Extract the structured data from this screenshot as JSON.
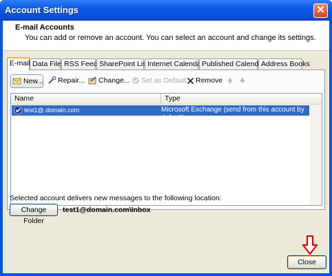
{
  "window": {
    "title": "Account Settings",
    "close_glyph": "✕"
  },
  "header": {
    "title": "E-mail Accounts",
    "description": "You can add or remove an account. You can select an account and change its settings."
  },
  "tabs": [
    {
      "label": "E-mail",
      "active": true
    },
    {
      "label": "Data Files"
    },
    {
      "label": "RSS Feeds"
    },
    {
      "label": "SharePoint Lists"
    },
    {
      "label": "Internet Calendars"
    },
    {
      "label": "Published Calendars"
    },
    {
      "label": "Address Books"
    }
  ],
  "toolbar": {
    "new": "New...",
    "repair": "Repair...",
    "change": "Change...",
    "set_default": "Set as Default",
    "remove": "Remove",
    "icons": [
      "new-account-icon",
      "repair-icon",
      "change-icon",
      "set-default-icon",
      "remove-icon",
      "move-up-icon",
      "move-down-icon"
    ]
  },
  "list": {
    "columns": {
      "name": "Name",
      "type": "Type"
    },
    "rows": [
      {
        "name": "test1@.domain.com",
        "type": "Microsoft Exchange (send from this account by default)"
      }
    ]
  },
  "delivery": {
    "text": "Selected account delivers new messages to the following location:",
    "change_folder": "Change Folder",
    "path": "test1@domain.com\\Inbox"
  },
  "footer": {
    "close": "Close"
  },
  "colors": {
    "title_bar": "#0a54e3",
    "selection": "#316ac5",
    "annotation_arrow": "#e00000"
  }
}
